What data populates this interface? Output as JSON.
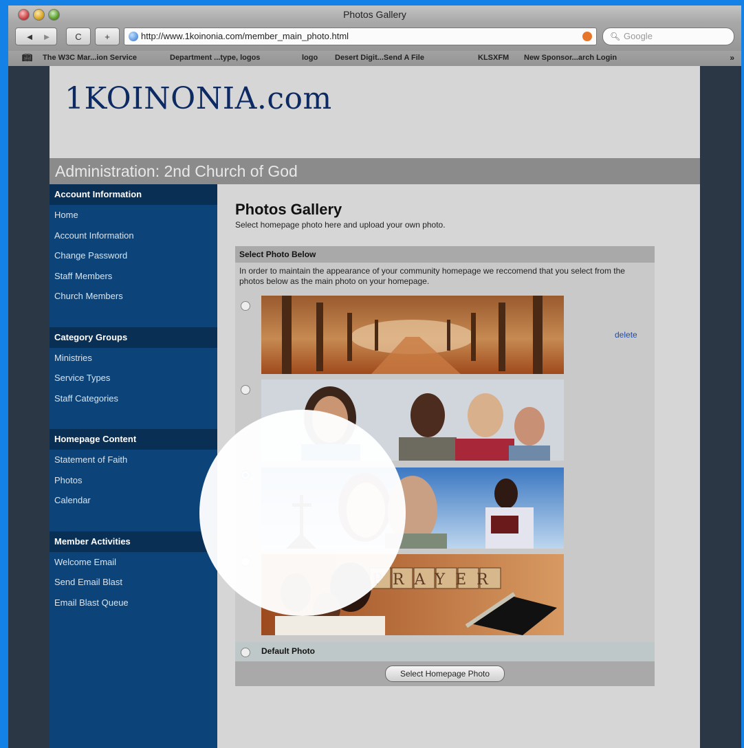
{
  "window": {
    "title": "Photos Gallery",
    "url": "http://www.1koinonia.com/member_main_photo.html",
    "search_placeholder": "Google",
    "back_label": "◄",
    "forward_label": "►",
    "reload_label": "C",
    "add_label": "+"
  },
  "bookmarks": [
    "The W3C Mar...ion Service",
    "Department ...type, logos",
    "logo",
    "Desert Digit...Send A File",
    "KLSXFM",
    "New Sponsor...arch Login"
  ],
  "site": {
    "logo": "1KOINONIA.com",
    "admin_title": "Administration: 2nd Church of God"
  },
  "sidebar": {
    "sections": [
      {
        "title": "Account Information",
        "items": [
          "Home",
          "Account Information",
          "Change Password",
          "Staff Members",
          "Church Members"
        ]
      },
      {
        "title": "Category Groups",
        "items": [
          "Ministries",
          "Service Types",
          "Staff Categories"
        ]
      },
      {
        "title": "Homepage Content",
        "items": [
          "Statement of Faith",
          "Photos",
          "Calendar"
        ]
      },
      {
        "title": "Member Activities",
        "items": [
          "Welcome Email",
          "Send Email Blast",
          "Email Blast Queue"
        ]
      }
    ]
  },
  "main": {
    "title": "Photos Gallery",
    "subtitle": "Select homepage photo here and upload your own photo.",
    "panel_title": "Select Photo Below",
    "panel_note": "In order to maintain the appearance of your community homepage we reccomend that you select from the photos below as the main photo on your homepage.",
    "delete_label": "delete",
    "prayer_word": "PRAYER",
    "default_label": "Default Photo",
    "submit_label": "Select Homepage Photo",
    "selected_photo_index": 2
  }
}
